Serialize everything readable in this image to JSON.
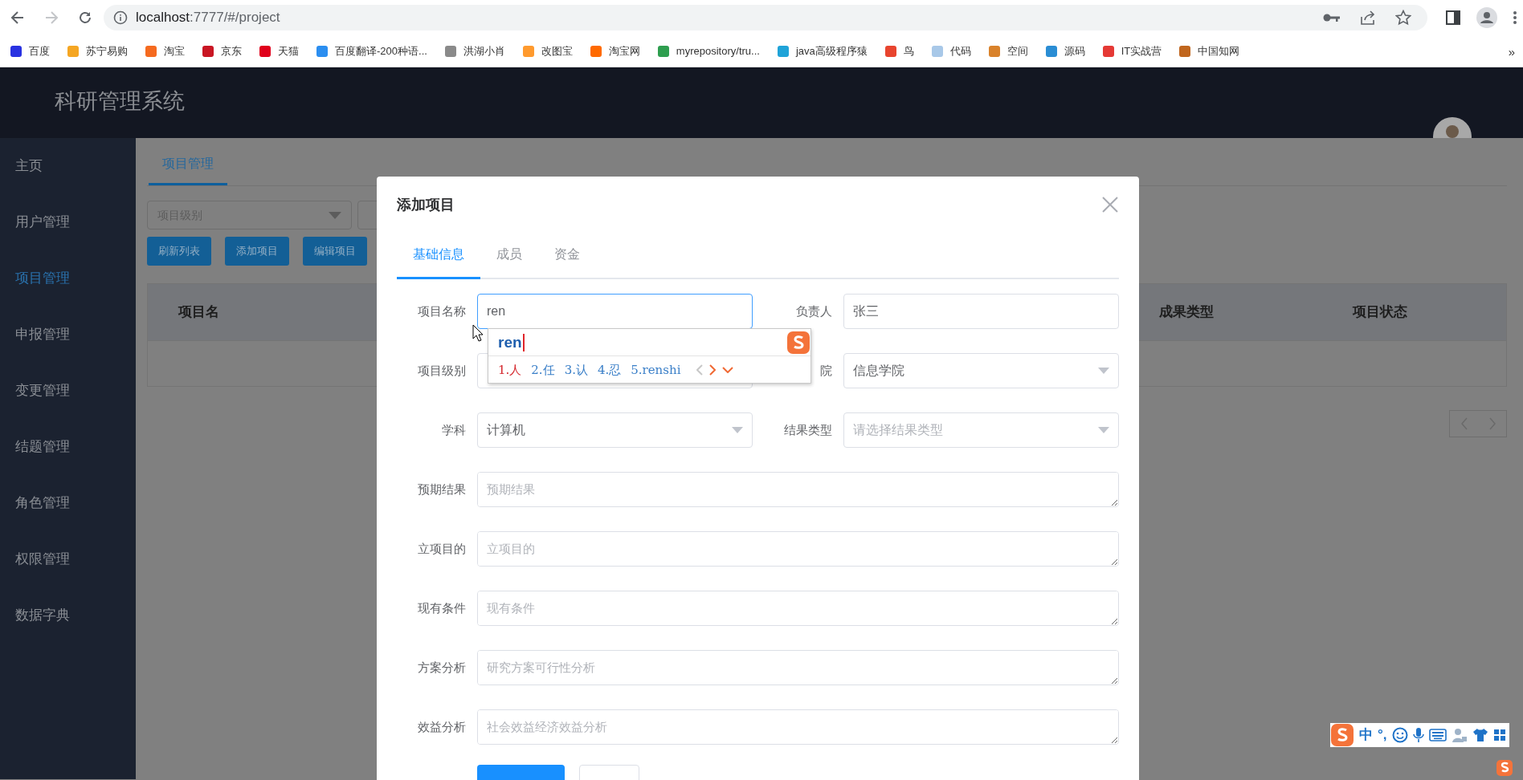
{
  "browser": {
    "forward_disabled": true,
    "url_host": "localhost",
    "url_path": ":7777/#/project",
    "bookmarks": [
      {
        "label": "百度",
        "color": "#2932e1"
      },
      {
        "label": "苏宁易购",
        "color": "#f5a623"
      },
      {
        "label": "淘宝",
        "color": "#f56a1f"
      },
      {
        "label": "京东",
        "color": "#c91623"
      },
      {
        "label": "天猫",
        "color": "#e0001b"
      },
      {
        "label": "百度翻译-200种语...",
        "color": "#2b8ef0"
      },
      {
        "label": "洪湖小肖",
        "color": "#8a8a8a"
      },
      {
        "label": "改图宝",
        "color": "#ff9a2e"
      },
      {
        "label": "淘宝网",
        "color": "#ff6a00"
      },
      {
        "label": "myrepository/tru...",
        "color": "#2e9e4f"
      },
      {
        "label": "java高级程序猿",
        "color": "#1fa3d8"
      },
      {
        "label": "鸟",
        "color": "#e8442e"
      },
      {
        "label": "代码",
        "color": "#a8c8e8"
      },
      {
        "label": "空间",
        "color": "#d9822b"
      },
      {
        "label": "源码",
        "color": "#2a8dd4"
      },
      {
        "label": "IT实战营",
        "color": "#e53935"
      },
      {
        "label": "中国知网",
        "color": "#c0661e"
      }
    ],
    "more": "»"
  },
  "app": {
    "title": "科研管理系统",
    "sidebar": [
      {
        "label": "主页",
        "selected": false
      },
      {
        "label": "用户管理",
        "selected": false
      },
      {
        "label": "项目管理",
        "selected": true
      },
      {
        "label": "申报管理",
        "selected": false
      },
      {
        "label": "变更管理",
        "selected": false
      },
      {
        "label": "结题管理",
        "selected": false
      },
      {
        "label": "角色管理",
        "selected": false
      },
      {
        "label": "权限管理",
        "selected": false
      },
      {
        "label": "数据字典",
        "selected": false
      }
    ],
    "tabs": [
      {
        "label": "项目管理",
        "selected": true
      }
    ],
    "filter_placeholder": "项目级别",
    "buttons": [
      "刷新列表",
      "添加项目",
      "编辑项目"
    ],
    "table": {
      "columns": [
        "项目名",
        "成果类型",
        "项目状态"
      ]
    }
  },
  "dialog": {
    "title": "添加项目",
    "tabs": [
      {
        "label": "基础信息",
        "selected": true
      },
      {
        "label": "成员",
        "selected": false
      },
      {
        "label": "资金",
        "selected": false
      }
    ],
    "fields": [
      {
        "label": "项目名称",
        "kind": "input",
        "value": "ren",
        "focused": true
      },
      {
        "label": "负责人",
        "kind": "input",
        "value": "张三",
        "focused": false
      },
      {
        "label": "项目级别",
        "kind": "select",
        "focused": false
      },
      {
        "label": "院",
        "kind": "select",
        "value": "信息学院",
        "focused": false
      },
      {
        "label": "学科",
        "kind": "select",
        "value": "计算机",
        "focused": false
      },
      {
        "label": "结果类型",
        "kind": "select",
        "placeholder": "请选择结果类型",
        "focused": false
      },
      {
        "label": "预期结果",
        "kind": "textarea",
        "placeholder": "预期结果",
        "focused": false
      },
      {
        "label": "立项目的",
        "kind": "textarea",
        "placeholder": "立项目的",
        "focused": false
      },
      {
        "label": "现有条件",
        "kind": "textarea",
        "placeholder": "现有条件",
        "focused": false
      },
      {
        "label": "方案分析",
        "kind": "textarea",
        "placeholder": "研究方案可行性分析",
        "focused": false
      },
      {
        "label": "效益分析",
        "kind": "textarea",
        "placeholder": "社会效益经济效益分析",
        "focused": false
      }
    ]
  },
  "ime": {
    "composition": "ren",
    "candidates": [
      {
        "label": "1.人",
        "selected": true
      },
      {
        "label": "2.任",
        "selected": false
      },
      {
        "label": "3.认",
        "selected": false
      },
      {
        "label": "4.忍",
        "selected": false
      },
      {
        "label": "5.renshi",
        "selected": false
      }
    ]
  },
  "ime_toolbar": {
    "mode": "中",
    "punctuation": "°,"
  }
}
